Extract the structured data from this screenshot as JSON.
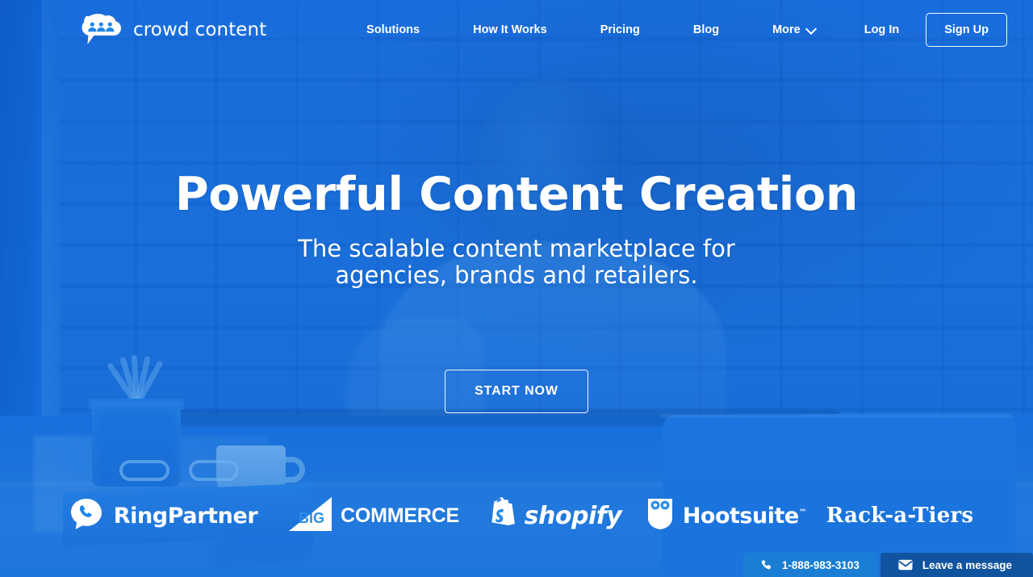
{
  "brand": {
    "logo_text_part1": "crowd",
    "logo_text_part2": "content",
    "logo_icon": "speech-bubble-people-icon",
    "accent_color": "#1d86e8",
    "dark_accent_color": "#10549f"
  },
  "header": {
    "nav": [
      {
        "label": "Solutions",
        "icon": ""
      },
      {
        "label": "How It Works",
        "icon": ""
      },
      {
        "label": "Pricing",
        "icon": ""
      },
      {
        "label": "Blog",
        "icon": ""
      },
      {
        "label": "More",
        "icon": "chevron-down-icon"
      }
    ],
    "login_label": "Log In",
    "signup_label": "Sign Up"
  },
  "hero": {
    "headline": "Powerful Content Creation",
    "subhead_line1": "The scalable content marketplace for",
    "subhead_line2": "agencies, brands and retailers.",
    "cta_label": "START NOW"
  },
  "partners": [
    {
      "name": "RingPartner",
      "icon": "phone-speech-bubble-icon"
    },
    {
      "name": "COMMERCE",
      "prefix": "BIG",
      "icon": "bigcommerce-triangle-icon"
    },
    {
      "name": "shopify",
      "icon": "shopping-bag-icon"
    },
    {
      "name": "Hootsuite",
      "trademark": "™",
      "icon": "owl-shield-icon"
    },
    {
      "name": "Rack-a-Tiers",
      "icon": ""
    }
  ],
  "chat_widget": {
    "phone_number": "1-888-983-3103",
    "phone_icon": "phone-icon",
    "message_label": "Leave a message",
    "message_icon": "envelope-icon"
  }
}
